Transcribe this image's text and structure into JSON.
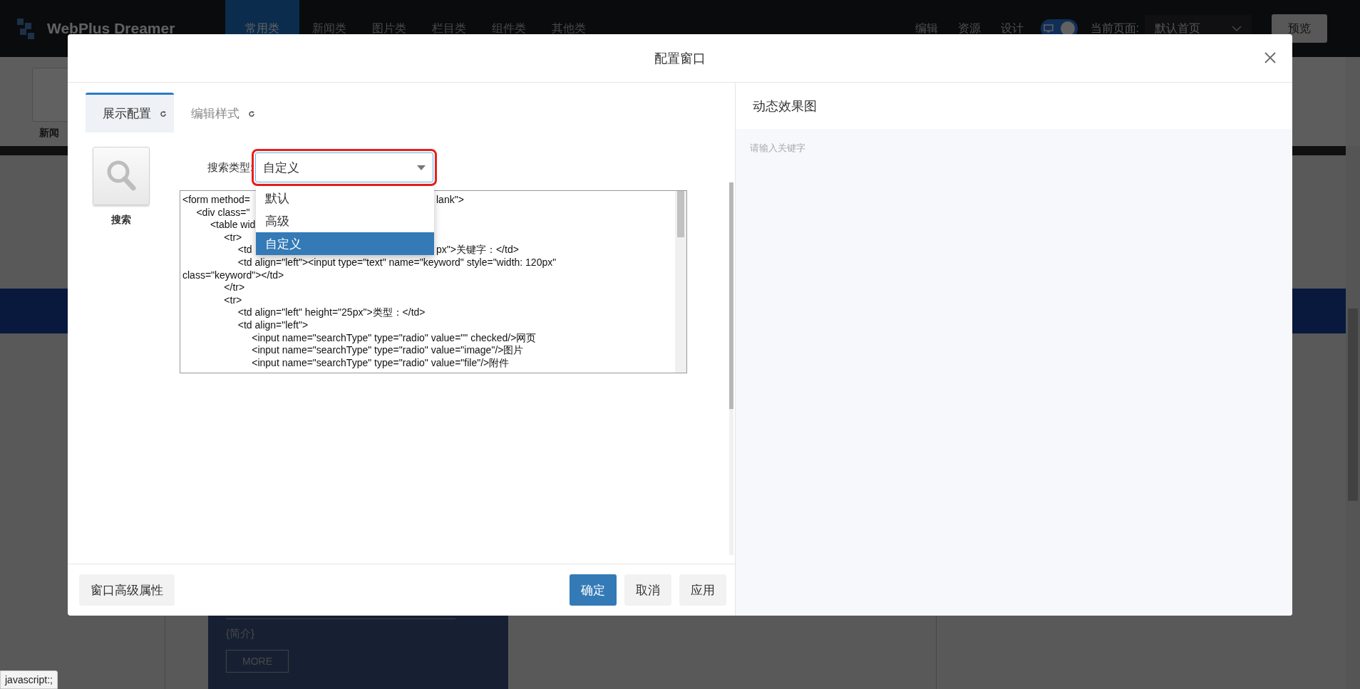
{
  "top_bar": {
    "logo": "WebPlus Dreamer",
    "categories": [
      {
        "label": "常用类",
        "selected": true
      },
      {
        "label": "新闻类",
        "selected": false
      },
      {
        "label": "图片类",
        "selected": false
      },
      {
        "label": "栏目类",
        "selected": false
      },
      {
        "label": "组件类",
        "selected": false
      },
      {
        "label": "其他类",
        "selected": false
      }
    ],
    "menu": [
      "编辑",
      "资源",
      "设计"
    ],
    "view_toggle": {
      "on": true
    },
    "current_page_label": "当前页面:",
    "current_page": "默认首页",
    "preview_button": "预览"
  },
  "background": {
    "widget_label": "新闻",
    "intro": "{简介}",
    "more_button": "MORE",
    "status_tip": "javascript:;"
  },
  "dialog": {
    "title": "配置窗口",
    "tabs": [
      {
        "label": "展示配置",
        "selected": true
      },
      {
        "label": "编辑样式",
        "selected": false
      }
    ],
    "widget": {
      "label": "搜索"
    },
    "search_type": {
      "label": "搜索类型:",
      "value": "自定义",
      "expanded": true,
      "options": [
        {
          "label": "默认",
          "selected": false
        },
        {
          "label": "高级",
          "selected": false
        },
        {
          "label": "自定义",
          "selected": true
        }
      ]
    },
    "code_lines": [
      {
        "text": "<form method=",
        "tail": "lank\">"
      },
      {
        "text": "     <div class=\""
      },
      {
        "text": "          <table wid"
      },
      {
        "text": "               <tr>"
      },
      {
        "text": "                    <td",
        "tail": "px\">关键字：</td>"
      },
      {
        "text": "                    <td align=\"left\"><input type=\"text\" name=\"keyword\" style=\"width: 120px\""
      },
      {
        "text": "class=\"keyword\"></td>"
      },
      {
        "text": "               </tr>"
      },
      {
        "text": "               <tr>"
      },
      {
        "text": "                    <td align=\"left\" height=\"25px\">类型：</td>"
      },
      {
        "text": "                    <td align=\"left\">"
      },
      {
        "text": "                         <input name=\"searchType\" type=\"radio\" value=\"\" checked/>网页"
      },
      {
        "text": "                         <input name=\"searchType\" type=\"radio\" value=\"image\"/>图片"
      },
      {
        "text": "                         <input name=\"searchType\" type=\"radio\" value=\"file\"/>附件"
      }
    ],
    "buttons": {
      "advanced": "窗口高级属性",
      "ok": "确定",
      "cancel": "取消",
      "apply": "应用"
    },
    "preview": {
      "title": "动态效果图",
      "placeholder": "请输入关键字"
    }
  }
}
